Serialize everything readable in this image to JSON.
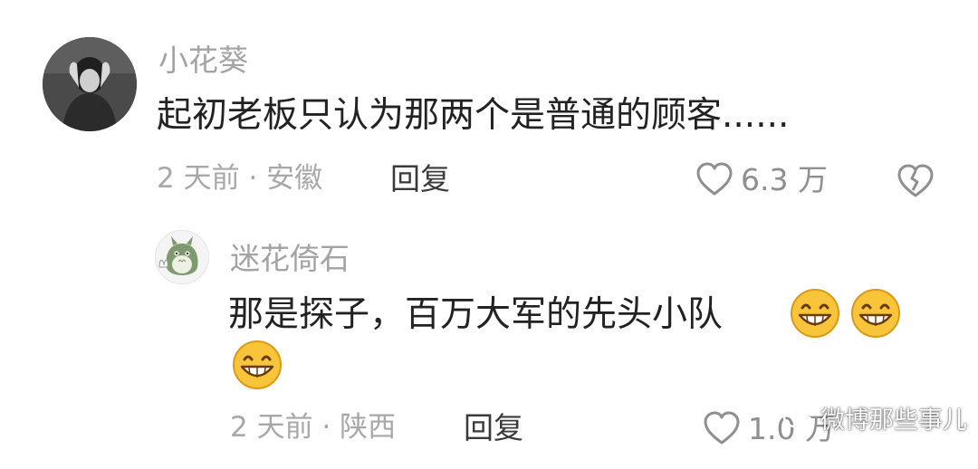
{
  "comment": {
    "username": "小花葵",
    "content": "起初老板只认为那两个是普通的顾客......",
    "meta": "2 天前 · 安徽",
    "reply_label": "回复",
    "like_count": "6.3 万",
    "like_icon": "heart-outline-icon",
    "dislike_icon": "broken-heart-icon"
  },
  "reply": {
    "username": "迷花倚石",
    "content": "那是探子，百万大军的先头小队",
    "emojis": [
      "grinning-emoji",
      "grinning-emoji",
      "grinning-emoji"
    ],
    "meta": "2 天前 · 陕西",
    "reply_label": "回复",
    "like_count": "1.0 万",
    "like_icon": "heart-outline-icon"
  },
  "watermark": {
    "text": "微博那些事儿",
    "icon": "wechat-icon"
  },
  "colors": {
    "username": "#a3a3a3",
    "content": "#222222",
    "meta": "#a8a8a8",
    "reply": "#3a3a3a",
    "icon": "#8f8f8f"
  }
}
